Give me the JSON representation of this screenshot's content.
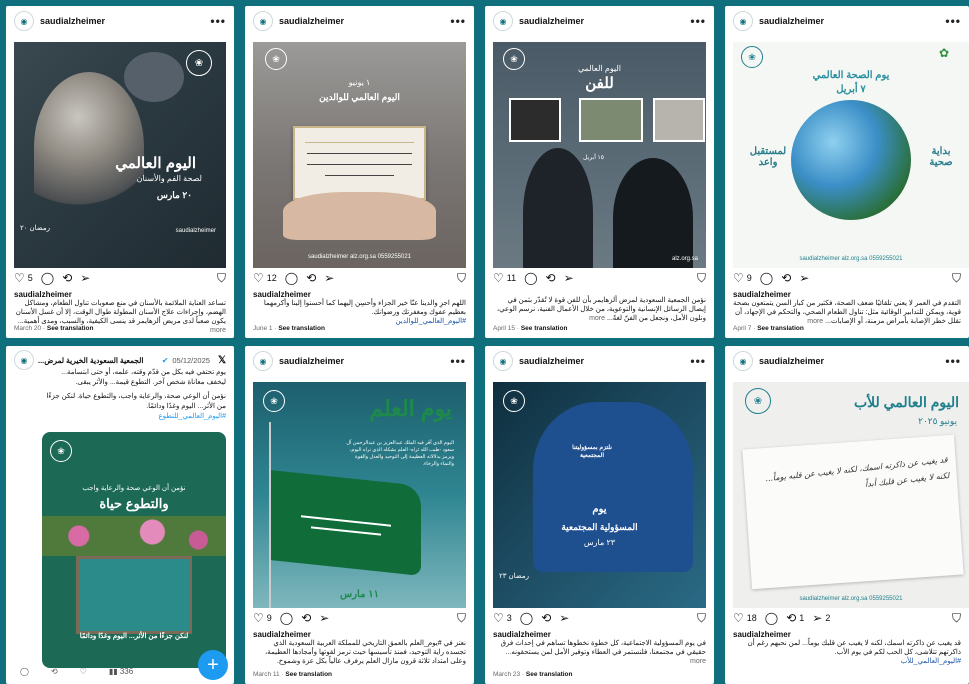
{
  "posts": [
    {
      "username": "saudialzheimer",
      "likes": "5",
      "image_title": "اليوم العالمي",
      "image_subtitle": "لصحة الفم والأسنان",
      "image_date": "٢٠ مارس",
      "image_ramadan": "رمضان ٢٠",
      "image_handle": "saudialzheimer",
      "caption_user": "saudialzheimer",
      "caption": "تساعد العناية الملائمة بالأسنان في منع صعوبات تناول الطعام، ومشاكل الهضم، وإجراءات علاج الأسنان المطولة طوال الوقت، إلا أن غسل الأسنان يكون صعباً لدى مريض ألزهايمر قد ينسى الكيفية، والسبب، ومدى أهمية...",
      "more": "more",
      "date": "March 20",
      "see_translation": "See translation"
    },
    {
      "username": "saudialzheimer",
      "likes": "12",
      "image_title": "١ يونيو",
      "image_subtitle": "اليوم العالمي للوالدين",
      "image_footer": "saudialzheimer   alz.org.sa   0559255021",
      "caption_user": "saudialzheimer",
      "caption": "اللهم اجزِ والدينا عنّا خير الجزاء وأحسِن إليهما كما أحسنوا إلينا وأكرمهما بعظيم عفوك ومغفرتك ورضوانك.",
      "hashtag": "#اليوم_العالمي_للوالدين",
      "date": "June 1",
      "see_translation": "See translation"
    },
    {
      "username": "saudialzheimer",
      "likes": "11",
      "image_title": "اليوم العالمي",
      "image_subtitle": "للفن",
      "image_date": "١٥ أبريل",
      "image_footer": "alz.org.sa",
      "caption": "نؤمن الجمعية السعودية لمرض ألزهايمر بأن للفن قوة لا تُقدّر بثمن في إيصال الرسائل الإنسانية والتوعوية، من خلال الأعمال الفنية، نرسم الوعي، ونلون الأمل، ونجعل من الفنّ لغةً...",
      "more": "more",
      "date": "April 15",
      "see_translation": "See translation"
    },
    {
      "username": "saudialzheimer",
      "likes": "9",
      "image_title": "يوم الصحة العالمي",
      "image_date": "٧ أبريل",
      "image_left": "لمستقبل واعد",
      "image_right": "بداية صحية",
      "image_footer": "saudialzheimer   alz.org.sa   0559255021",
      "caption_user": "saudialzheimer",
      "caption": "التقدم في العمر لا يعني تلقائيًا ضعف الصحة، فكثير من كبار السن يتمتعون بصحة قوية، ويمكن للتدابير الوقائية مثل: تناول الطعام الصحي، والتحكم في الإجهاد، أن تقلل خطر الإصابة بأمراض مزمنة، أو الإصابات...",
      "more": "more",
      "date": "April 7",
      "see_translation": "See translation"
    },
    {
      "account_name": "الجمعية السعودية الخيرية لمرض...",
      "date_text": "05/12/2025",
      "text1": "يوم تحتفي فيه بكل من قدّم وقته، علمه، أو حتى ابتسامة... ليخفف معاناة شخص آخر. التطوع قيمة... والأثر يبقى.",
      "text2": "نؤمن أن الوعي صحة، والرعاية واجب، والتطوع حياة. لنكن جزءًا من الأثر... اليوم وغدًا ودائمًا.",
      "hashtag": "#اليوم_العالمي_للتطوع",
      "image_title": "نؤمن أن الوعي صحة والرعاية واجب",
      "image_subtitle": "والتطوع حياة",
      "image_bottom": "لنكن جزءًا من الأثر... اليوم وغدًا ودائمًا",
      "views": "336",
      "fab": "+"
    },
    {
      "username": "saudialzheimer",
      "likes": "9",
      "image_title": "يوم العلم",
      "image_body": "اليوم الذي أقر فيه الملك عبدالعزيز بن عبدالرحمن آل سعود -طيب الله ثراه- العلم بشكله الذي نراه اليوم، ويرمز بدلالاته العظيمة إلى التوحيد والعدل والقوة والنماء والرخاء.",
      "image_date": "١١ مارس",
      "caption_user": "saudialzheimer",
      "caption": "نعتز في #يوم_العلم بالعمق التاريخي للمملكة العربية السعودية الذي تجسده راية التوحيد، فمنذ تأسيسها حيث ترمز لقوتها وأمجادها العظيمة، وعلى امتداد ثلاثة قرون مازال العلم يرفرف عالياً بكل عزة وشموخ.",
      "date": "March 11",
      "see_translation": "See translation"
    },
    {
      "username": "saudialzheimer",
      "likes": "3",
      "image_title": "يوم",
      "image_subtitle": "المسؤولية المجتمعية",
      "image_date": "٢٣ مارس",
      "image_badge": "نلتزم بمسؤوليتنا المجتمعية",
      "image_ramadan": "رمضان ٢٣",
      "caption_user": "saudialzheimer",
      "caption": "في يوم المسؤولية الاجتماعية، كل خطوة نخطوها تساهم في إحداث فرق حقيقي في مجتمعنا، فلنستمر في العطاء وتوفير الأمل لمن يستحقونه...",
      "more": "more",
      "date": "March 23",
      "see_translation": "See translation"
    },
    {
      "username": "saudialzheimer",
      "likes": "18",
      "reposts": "1",
      "shares": "2",
      "image_title": "اليوم العالمي للأب",
      "image_date": "يونيو ٢٠٢٥",
      "image_handwriting": "قد يغيب عن ذاكرته اسمك، لكنه لا يغيب عن قلبه يوماً... لكنه لا يغيب عن قلبك أبداً",
      "image_footer": "saudialzheimer   alz.org.sa   0559255021",
      "caption_user": "saudialzheimer",
      "caption": "قد يغيب عن ذاكرته اسمك، لكنه لا يغيب عن قلبك يوماً... لمن نحبهم رغم أن ذاكرتهم تتلاشى، كل الحب لكم في يوم الأب.",
      "hashtag": "#اليوم_العالمي_للأب",
      "date": "June 15",
      "see_translation": "See translation"
    }
  ],
  "colors": {
    "background": "#0f6f7d",
    "brand_teal": "#1f7f8c",
    "twitter_blue": "#1d9bf0",
    "hashtag_blue": "#1a55a8"
  },
  "icons": {
    "like": "heart-icon",
    "comment": "comment-icon",
    "repost": "repost-icon",
    "share": "share-icon",
    "save": "bookmark-icon"
  }
}
